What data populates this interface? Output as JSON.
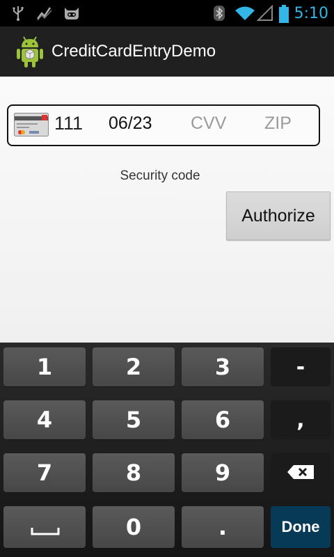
{
  "status_bar": {
    "left_icons": [
      "usb-icon",
      "activity-icon",
      "cyanogen-icon"
    ],
    "right_icons": [
      "bluetooth-icon",
      "wifi-icon",
      "signal-icon",
      "battery-icon"
    ],
    "time": "5:10",
    "accent_color": "#33b5e5"
  },
  "action_bar": {
    "app_icon": "android-icon",
    "title": "CreditCardEntryDemo"
  },
  "form": {
    "card_icon": "credit-card-icon",
    "card_number": "111",
    "expiry": "06/23",
    "cvv_placeholder": "CVV",
    "zip_placeholder": "ZIP",
    "hint": "Security code",
    "authorize_label": "Authorize"
  },
  "keyboard": {
    "row1": [
      "1",
      "2",
      "3",
      "-"
    ],
    "row2": [
      "4",
      "5",
      "6",
      ","
    ],
    "row3": [
      "7",
      "8",
      "9"
    ],
    "row4": [
      "0",
      "."
    ],
    "backspace_icon": "backspace-icon",
    "space_icon": "space-bar-icon",
    "done_label": "Done",
    "done_color": "#073a57"
  }
}
